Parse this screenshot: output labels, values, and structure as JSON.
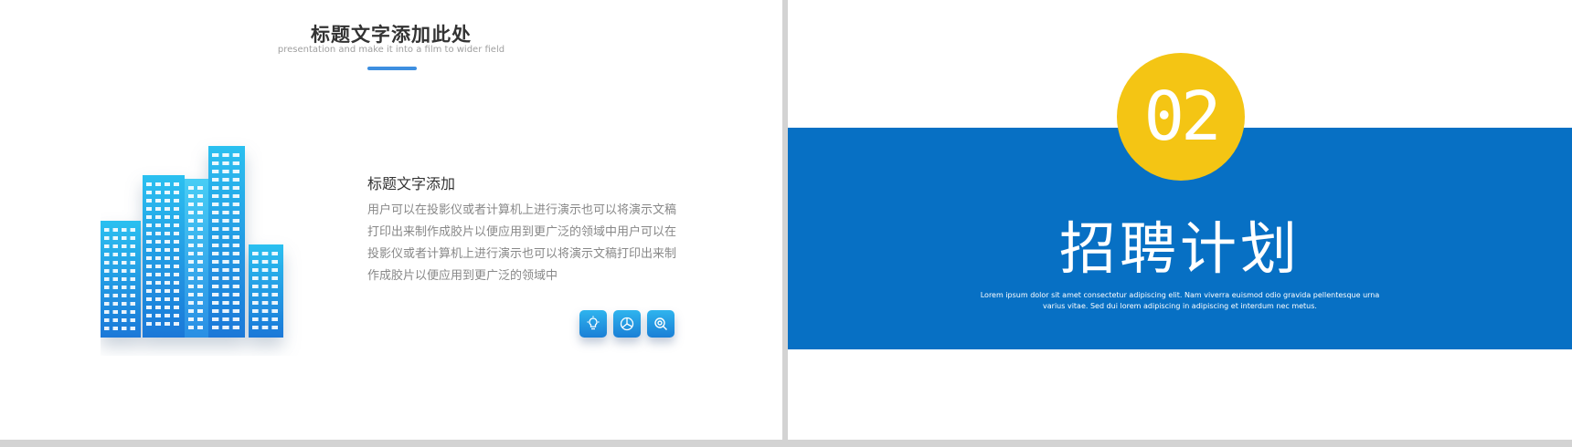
{
  "left_slide": {
    "title": "标题文字添加此处",
    "subtitle": "presentation and make it into a film to wider field",
    "section_title": "标题文字添加",
    "section_body": "用户可以在投影仪或者计算机上进行演示也可以将演示文稿打印出来制作成胶片以便应用到更广泛的领域中用户可以在投影仪或者计算机上进行演示也可以将演示文稿打印出来制作成胶片以便应用到更广泛的领域中",
    "illustration": "buildings-icon",
    "icons": [
      "lightbulb-icon",
      "chart-icon",
      "search-icon"
    ],
    "accent_color": "#3d8fe0"
  },
  "right_slide": {
    "number": "02",
    "title": "招聘计划",
    "description": "Lorem ipsum dolor sit amet consectetur adipiscing elit. Nam viverra euismod odio gravida pellentesque urna varius vitae. Sed dui lorem adipiscing in adipiscing et interdum nec metus.",
    "band_color": "#0770c4",
    "circle_color": "#f4c514"
  }
}
